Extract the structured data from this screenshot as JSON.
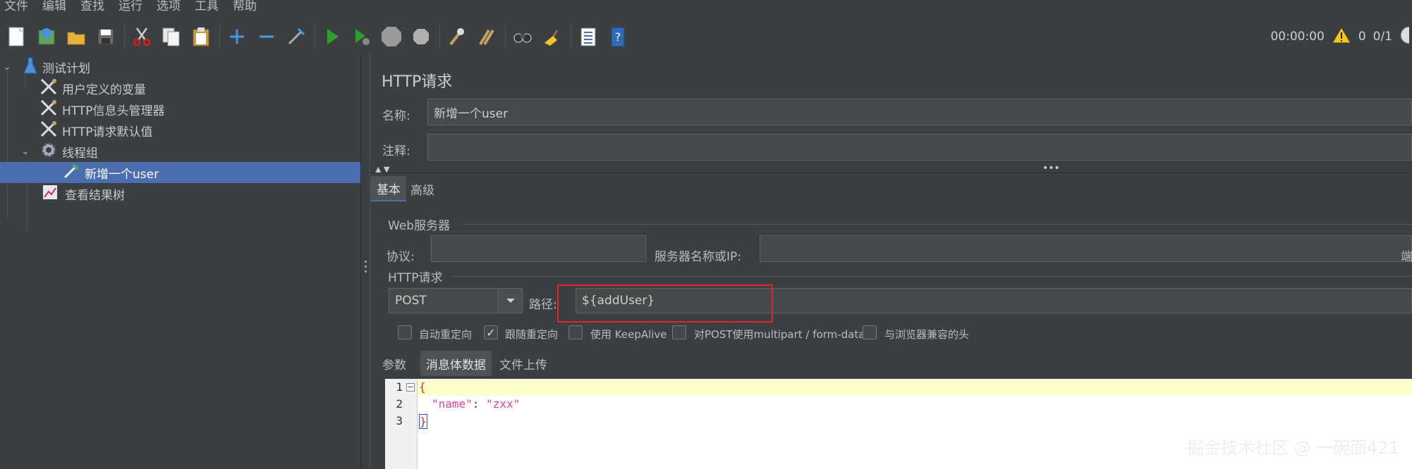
{
  "menu": [
    "文件",
    "编辑",
    "查找",
    "运行",
    "选项",
    "工具",
    "帮助"
  ],
  "toolbar": {
    "timer": "00:00:00",
    "warnings": "0",
    "threads": "0/1",
    "icons": [
      "new-icon",
      "templates-icon",
      "open-icon",
      "save-icon",
      "cut-icon",
      "copy-icon",
      "paste-icon",
      "expand-icon",
      "collapse-icon",
      "toggle-icon",
      "start-icon",
      "start-no-pause-icon",
      "stop-icon",
      "shutdown-icon",
      "clear-icon",
      "clear-all-icon",
      "search-icon",
      "reset-search-icon",
      "function-helper-icon",
      "help-icon"
    ]
  },
  "tree": {
    "items": [
      {
        "label": "测试计划",
        "icon": "test-plan-icon"
      },
      {
        "label": "用户定义的变量",
        "icon": "config-tools-icon"
      },
      {
        "label": "HTTP信息头管理器",
        "icon": "config-tools-icon"
      },
      {
        "label": "HTTP请求默认值",
        "icon": "config-tools-icon"
      },
      {
        "label": "线程组",
        "icon": "gear-icon"
      },
      {
        "label": "新增一个user",
        "icon": "pipette-icon"
      },
      {
        "label": "查看结果树",
        "icon": "graph-icon"
      }
    ]
  },
  "panel": {
    "title": "HTTP请求",
    "name_label": "名称:",
    "name_value": "新增一个user",
    "comment_label": "注释:",
    "comment_value": "",
    "tabs": [
      "基本",
      "高级"
    ],
    "web_server_group": "Web服务器",
    "protocol_label": "协议:",
    "protocol_value": "",
    "server_label": "服务器名称或IP:",
    "server_value": "",
    "port_label": "端",
    "http_request_group": "HTTP请求",
    "method": "POST",
    "path_label": "路径:",
    "path_value": "${addUser}",
    "checkboxes": [
      {
        "label": "自动重定向",
        "checked": false
      },
      {
        "label": "跟随重定向",
        "checked": true
      },
      {
        "label": "使用 KeepAlive",
        "checked": false
      },
      {
        "label": "对POST使用multipart / form-data",
        "checked": false
      },
      {
        "label": "与浏览器兼容的头",
        "checked": false
      }
    ],
    "body_tabs": [
      "参数",
      "消息体数据",
      "文件上传"
    ],
    "editor": {
      "lines": [
        "1",
        "2",
        "3"
      ],
      "line1": "{",
      "line2_key": "\"name\"",
      "line2_colon": ":",
      "line2_value": "\"zxx\"",
      "line3": "}"
    }
  },
  "checkmark": "✓",
  "collapse_toggle": "−",
  "watermark": "掘金技术社区 @ 一碗面421",
  "colors": {
    "selected": "#4b6eaf",
    "highlight_box": "#e0252a",
    "editor_current_line": "#ffffcc"
  }
}
